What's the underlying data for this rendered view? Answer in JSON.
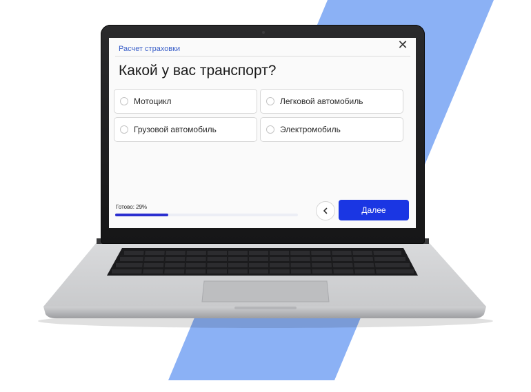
{
  "quiz": {
    "title": "Расчет страховки",
    "question": "Какой у вас транспорт?",
    "options": [
      {
        "label": "Мотоцикл"
      },
      {
        "label": "Легковой автомобиль"
      },
      {
        "label": "Грузовой автомобиль"
      },
      {
        "label": "Электромобиль"
      }
    ],
    "progress_label": "Готово: 29%",
    "progress_percent": 29,
    "next_label": "Далее"
  },
  "icons": {
    "close": "close-icon",
    "back": "chevron-left-icon",
    "radio": "radio-unchecked-icon"
  },
  "colors": {
    "accent": "#1a36e3",
    "progress": "#2b2fd0",
    "link": "#3a5fc8",
    "stripe": "#87adf4"
  }
}
